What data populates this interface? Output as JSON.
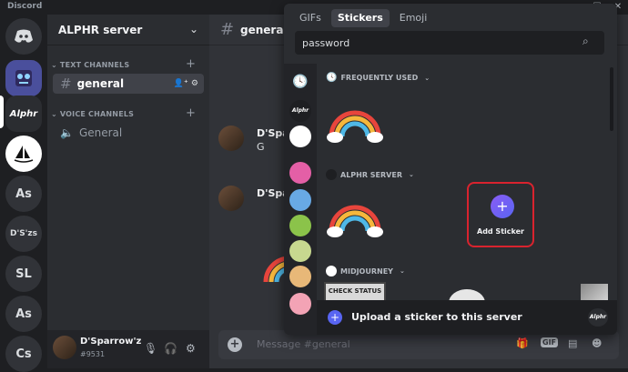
{
  "app": {
    "title": "Discord"
  },
  "rail": {
    "servers": [
      {
        "label": "Alphr"
      },
      {
        "label": "As"
      },
      {
        "label": "D'S'zs"
      },
      {
        "label": "SL"
      },
      {
        "label": "As"
      },
      {
        "label": "Cs"
      }
    ]
  },
  "sidebar": {
    "server_name": "ALPHR server",
    "text_category": "TEXT CHANNELS",
    "voice_category": "VOICE CHANNELS",
    "text_channels": [
      {
        "label": "general"
      }
    ],
    "voice_channels": [
      {
        "label": "General"
      }
    ]
  },
  "user": {
    "name": "D'Sparrow'z",
    "tag": "#9531"
  },
  "chat": {
    "channel": "general",
    "messages": [
      {
        "author": "D'Sparr",
        "text": "G"
      },
      {
        "author": "D'Sparr",
        "text": ""
      }
    ],
    "composer_placeholder": "Message #general",
    "gif_label": "GIF"
  },
  "picker": {
    "tabs": [
      {
        "label": "GIFs",
        "active": false
      },
      {
        "label": "Stickers",
        "active": true
      },
      {
        "label": "Emoji",
        "active": false
      }
    ],
    "search_value": "password",
    "sections": [
      {
        "label": "FREQUENTLY USED"
      },
      {
        "label": "ALPHR SERVER"
      },
      {
        "label": "MIDJOURNEY"
      }
    ],
    "add_sticker_label": "Add Sticker",
    "check_status_label": "CHECK STATUS",
    "upload_text": "Upload a sticker to this server",
    "badge_label": "Alphr",
    "rail_badge": "Alphr"
  },
  "colors": {
    "accent": "#5865f2",
    "highlight": "#d9232e"
  }
}
